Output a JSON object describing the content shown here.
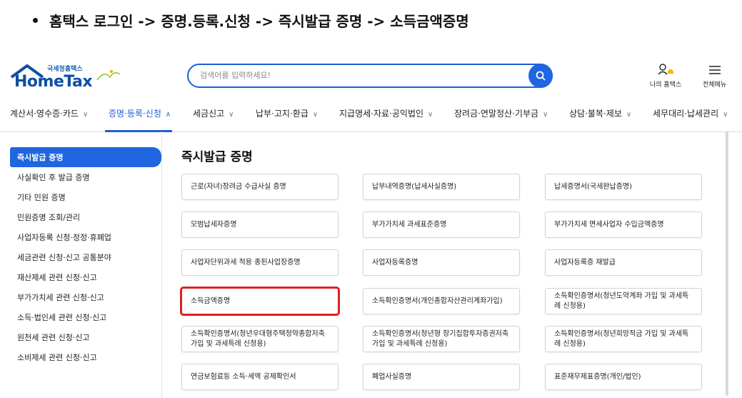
{
  "caption": "홈택스 로그인 -> 증명.등록.신청 -> 즉시발급 증명 -> 소득금액증명",
  "logo": {
    "sub": "국세청홈택스",
    "main": "HomeTax"
  },
  "search": {
    "placeholder": "검색어를 입력하세요!"
  },
  "utils": {
    "my_hometax": "나의 홈택스",
    "all_menu": "전체메뉴"
  },
  "gnb": [
    "계산서·영수증·카드",
    "증명·등록·신청",
    "세금신고",
    "납부·고지·환급",
    "지급명세·자료·공익법인",
    "장려금·연말정산·기부금",
    "상담·불복·제보",
    "세무대리·납세관리"
  ],
  "sidebar": [
    "즉시발급 증명",
    "사실확인 후 발급 증명",
    "기타 민원 증명",
    "민원증명 조회/관리",
    "사업자등록 신청·정정·휴폐업",
    "세금관련 신청·신고 공통분야",
    "재산제세 관련 신청·신고",
    "부가가치세 관련 신청·신고",
    "소득·법인세 관련 신청·신고",
    "원천세 관련 신청·신고",
    "소비제세 관련 신청·신고"
  ],
  "section_title": "즉시발급 증명",
  "cards": [
    "근로(자녀)장려금 수급사실 증명",
    "납부내역증명(납세사실증명)",
    "납세증명서(국세완납증명)",
    "모범납세자증명",
    "부가가치세 과세표준증명",
    "부가가치세 면세사업자 수입금액증명",
    "사업자단위과세 적용 종된사업장증명",
    "사업자등록증명",
    "사업자등록증 재발급",
    "소득금액증명",
    "소득확인증명서(개인종합자산관리계좌가입)",
    "소득확인증명서(청년도약계좌 가입 및 과세특례 신청용)",
    "소득확인증명서(청년우대형주택청약종합저축 가입 및 과세특례 신청용)",
    "소득확인증명서(청년형 장기집합투자증권저축 가입 및 과세특례 신청용)",
    "소득확인증명서(청년희망적금 가입 및 과세특례 신청용)",
    "연금보험료등 소득·세액 공제확인서",
    "폐업사실증명",
    "표준재무제표증명(개인/법인)"
  ],
  "colors": {
    "accent": "#1f66e0",
    "highlight": "#e02020"
  }
}
